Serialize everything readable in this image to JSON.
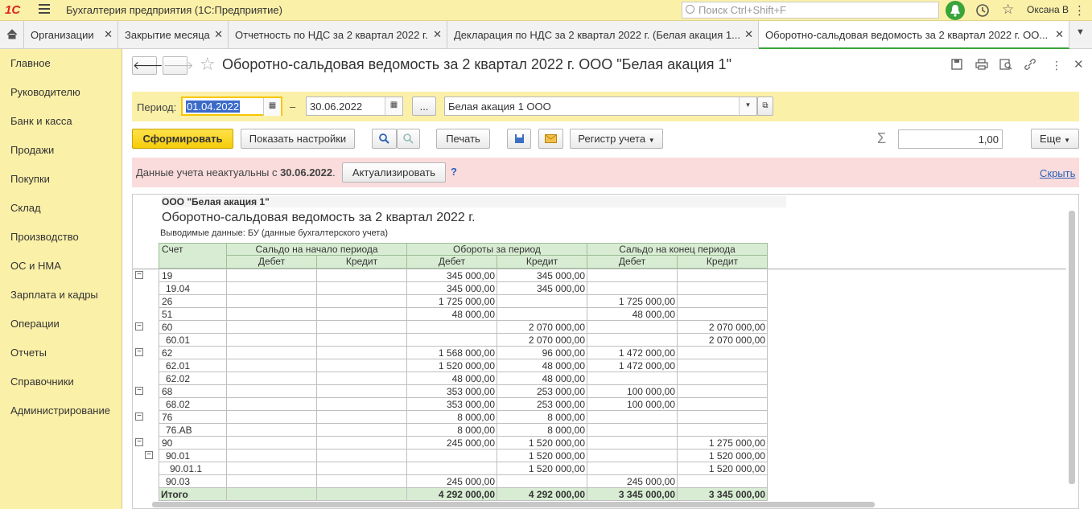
{
  "titlebar": {
    "logo": "1С",
    "app_title": "Бухгалтерия предприятия  (1С:Предприятие)",
    "search_placeholder": "Поиск Ctrl+Shift+F",
    "user": "Оксана В"
  },
  "tabs": [
    {
      "label": "Организации"
    },
    {
      "label": "Закрытие месяца"
    },
    {
      "label": "Отчетность по НДС за 2 квартал 2022 г."
    },
    {
      "label": "Декларация по НДС за 2 квартал 2022 г. (Белая акация 1..."
    },
    {
      "label": "Оборотно-сальдовая ведомость за 2 квартал 2022 г. ОО..."
    }
  ],
  "sidebar": {
    "items": [
      {
        "label": "Главное"
      },
      {
        "label": "Руководителю"
      },
      {
        "label": "Банк и касса"
      },
      {
        "label": "Продажи"
      },
      {
        "label": "Покупки"
      },
      {
        "label": "Склад"
      },
      {
        "label": "Производство"
      },
      {
        "label": "ОС и НМА"
      },
      {
        "label": "Зарплата и кадры"
      },
      {
        "label": "Операции"
      },
      {
        "label": "Отчеты"
      },
      {
        "label": "Справочники"
      },
      {
        "label": "Администрирование"
      }
    ]
  },
  "doc": {
    "title": "Оборотно-сальдовая ведомость за 2 квартал 2022 г. ООО \"Белая акация 1\""
  },
  "period": {
    "label": "Период:",
    "from": "01.04.2022",
    "dash": "–",
    "to": "30.06.2022",
    "dots": "...",
    "org": "Белая акация 1 ООО"
  },
  "toolbar": {
    "generate": "Сформировать",
    "settings": "Показать настройки",
    "print": "Печать",
    "register": "Регистр учета",
    "sum_value": "1,00",
    "more": "Еще"
  },
  "warning": {
    "text_prefix": "Данные учета неактуальны с ",
    "date": "30.06.2022",
    "text_suffix": ".",
    "update": "Актуализировать",
    "help": "?",
    "hide": "Скрыть"
  },
  "report": {
    "org": "ООО \"Белая акация 1\"",
    "title": "Оборотно-сальдовая ведомость за 2 квартал 2022 г.",
    "subtitle": "Выводимые данные:  БУ (данные бухгалтерского учета)",
    "col_account": "Счет",
    "col_open": "Сальдо на начало периода",
    "col_turnover": "Обороты за период",
    "col_close": "Сальдо на конец периода",
    "debit": "Дебет",
    "credit": "Кредит",
    "rows": [
      {
        "acc": "19",
        "indent": 0,
        "od": "",
        "oc": "",
        "td": "345 000,00",
        "tc": "345 000,00",
        "cd": "",
        "cc": ""
      },
      {
        "acc": "19.04",
        "indent": 1,
        "od": "",
        "oc": "",
        "td": "345 000,00",
        "tc": "345 000,00",
        "cd": "",
        "cc": ""
      },
      {
        "acc": "26",
        "indent": 0,
        "od": "",
        "oc": "",
        "td": "1 725 000,00",
        "tc": "",
        "cd": "1 725 000,00",
        "cc": ""
      },
      {
        "acc": "51",
        "indent": 0,
        "od": "",
        "oc": "",
        "td": "48 000,00",
        "tc": "",
        "cd": "48 000,00",
        "cc": ""
      },
      {
        "acc": "60",
        "indent": 0,
        "od": "",
        "oc": "",
        "td": "",
        "tc": "2 070 000,00",
        "cd": "",
        "cc": "2 070 000,00"
      },
      {
        "acc": "60.01",
        "indent": 1,
        "od": "",
        "oc": "",
        "td": "",
        "tc": "2 070 000,00",
        "cd": "",
        "cc": "2 070 000,00"
      },
      {
        "acc": "62",
        "indent": 0,
        "od": "",
        "oc": "",
        "td": "1 568 000,00",
        "tc": "96 000,00",
        "cd": "1 472 000,00",
        "cc": ""
      },
      {
        "acc": "62.01",
        "indent": 1,
        "od": "",
        "oc": "",
        "td": "1 520 000,00",
        "tc": "48 000,00",
        "cd": "1 472 000,00",
        "cc": ""
      },
      {
        "acc": "62.02",
        "indent": 1,
        "od": "",
        "oc": "",
        "td": "48 000,00",
        "tc": "48 000,00",
        "cd": "",
        "cc": ""
      },
      {
        "acc": "68",
        "indent": 0,
        "od": "",
        "oc": "",
        "td": "353 000,00",
        "tc": "253 000,00",
        "cd": "100 000,00",
        "cc": ""
      },
      {
        "acc": "68.02",
        "indent": 1,
        "od": "",
        "oc": "",
        "td": "353 000,00",
        "tc": "253 000,00",
        "cd": "100 000,00",
        "cc": ""
      },
      {
        "acc": "76",
        "indent": 0,
        "od": "",
        "oc": "",
        "td": "8 000,00",
        "tc": "8 000,00",
        "cd": "",
        "cc": ""
      },
      {
        "acc": "76.АВ",
        "indent": 1,
        "od": "",
        "oc": "",
        "td": "8 000,00",
        "tc": "8 000,00",
        "cd": "",
        "cc": ""
      },
      {
        "acc": "90",
        "indent": 0,
        "od": "",
        "oc": "",
        "td": "245 000,00",
        "tc": "1 520 000,00",
        "cd": "",
        "cc": "1 275 000,00"
      },
      {
        "acc": "90.01",
        "indent": 1,
        "od": "",
        "oc": "",
        "td": "",
        "tc": "1 520 000,00",
        "cd": "",
        "cc": "1 520 000,00"
      },
      {
        "acc": "90.01.1",
        "indent": 2,
        "od": "",
        "oc": "",
        "td": "",
        "tc": "1 520 000,00",
        "cd": "",
        "cc": "1 520 000,00"
      },
      {
        "acc": "90.03",
        "indent": 1,
        "od": "",
        "oc": "",
        "td": "245 000,00",
        "tc": "",
        "cd": "245 000,00",
        "cc": ""
      }
    ],
    "total": {
      "acc": "Итого",
      "od": "",
      "oc": "",
      "td": "4 292 000,00",
      "tc": "4 292 000,00",
      "cd": "3 345 000,00",
      "cc": "3 345 000,00"
    }
  }
}
